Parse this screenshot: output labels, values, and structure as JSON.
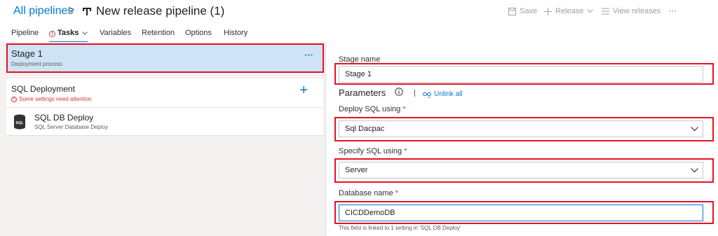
{
  "header": {
    "breadcrumb_link": "All pipelines",
    "breadcrumb_separator": ">",
    "title": "New release pipeline (1)",
    "pipeline_icon": "pipeline-icon",
    "toolbar": {
      "save_label": "Save",
      "release_label": "Release",
      "view_releases_label": "View releases",
      "more_label": "···"
    }
  },
  "tabs": [
    {
      "label": "Pipeline",
      "active": false
    },
    {
      "label": "Tasks",
      "active": true,
      "warning": true
    },
    {
      "label": "Variables",
      "active": false
    },
    {
      "label": "Retention",
      "active": false
    },
    {
      "label": "Options",
      "active": false
    },
    {
      "label": "History",
      "active": false
    }
  ],
  "left_pane": {
    "stage": {
      "title": "Stage 1",
      "subtitle": "Deployment process",
      "more_label": "···",
      "selected": true
    },
    "job": {
      "title": "SQL Deployment",
      "warning_text": "Some settings need attention",
      "add_label": "+"
    },
    "task": {
      "icon": "database-icon",
      "icon_text": "SQL",
      "title": "SQL DB Deploy",
      "subtitle": "SQL Server Database Deploy"
    }
  },
  "right_pane": {
    "stage_name": {
      "label": "Stage name",
      "value": "Stage 1"
    },
    "parameters": {
      "heading": "Parameters",
      "unlink_label": "Unlink all"
    },
    "deploy_sql_using": {
      "label": "Deploy SQL using",
      "required": "*",
      "value": "Sql Dacpac"
    },
    "specify_sql_using": {
      "label": "Specify SQL using",
      "required": "*",
      "value": "Server"
    },
    "database_name": {
      "label": "Database name",
      "required": "*",
      "value": "CICDDemoDB",
      "helper": "This field is linked to 1 setting in 'SQL DB Deploy'"
    }
  },
  "colors": {
    "accent": "#0078d4",
    "highlight_outline": "#e81123",
    "selected_stage_bg": "#cfe3f6",
    "warning": "#d13438"
  }
}
